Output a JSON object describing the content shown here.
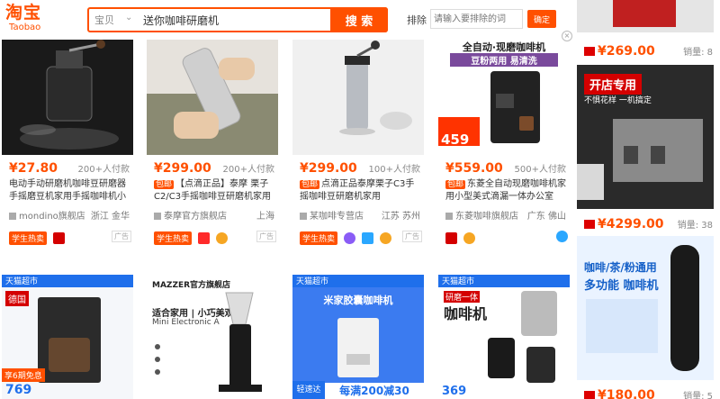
{
  "header": {
    "logo_cn": "淘宝",
    "logo_en": "Taobao",
    "search_category": "宝贝",
    "search_query": "送你咖啡研磨机",
    "search_button": "搜 索",
    "exclude_label": "排除",
    "exclude_placeholder": "请输入要排除的词",
    "confirm_button": "确定"
  },
  "row1": [
    {
      "price": "¥27.80",
      "sales": "200+人付款",
      "baoyou": "",
      "title": "电动手动研磨机咖啡豆研磨器手摇磨豆机家用手摇咖啡机小型",
      "shop": "mondino旗舰店",
      "loc": "浙江 金华",
      "badge": "学生热卖",
      "ad": "广告"
    },
    {
      "price": "¥299.00",
      "sales": "200+人付款",
      "baoyou": "包邮",
      "title": "【点滴正品】泰摩 栗子C2/C3手摇咖啡豆研磨机家用便携",
      "shop": "泰摩官方旗舰店",
      "loc": "上海",
      "badge": "学生热卖",
      "ad": "广告"
    },
    {
      "price": "¥299.00",
      "sales": "100+人付款",
      "baoyou": "包邮",
      "title": "点滴正品泰摩栗子C3手摇咖啡豆研磨机家用",
      "shop": "某咖啡专营店",
      "loc": "江苏 苏州",
      "badge": "学生热卖",
      "ad": "广告"
    },
    {
      "price": "¥559.00",
      "sales": "500+人付款",
      "baoyou": "包邮",
      "title": "东菱全自动现磨咖啡机家用小型美式滴漏一体办公室",
      "shop": "东菱咖啡旗舰店",
      "loc": "广东 佛山",
      "badge": "",
      "ad": "广告",
      "img_line1": "全自动·现磨咖啡机",
      "img_line2": "豆粉两用 易清洗",
      "img_price": "459"
    }
  ],
  "row2": [
    {
      "top_tag": "天猫超市",
      "country": "德国",
      "bottom": "享6期免息",
      "price_hint": "769"
    },
    {
      "brand": "MAZZER官方旗舰店",
      "line1": "适合家用 | 小巧美观",
      "line2": "Mini Electronic A"
    },
    {
      "top_tag": "天猫超市",
      "line1": "米家胶囊咖啡机",
      "tag1": "轻速达",
      "tag2": "每满200减30"
    },
    {
      "top_tag": "天猫超市",
      "line1": "咖啡机",
      "line2": "研磨一体",
      "price_hint": "369"
    }
  ],
  "right": {
    "price1": "¥269.00",
    "sales1": "销量: 8",
    "banner1": "开店专用",
    "banner1b": "不惧花样 一机搞定",
    "price2": "¥4299.00",
    "sales2": "销量: 38",
    "banner2": "咖啡/茶/粉通用",
    "banner2b": "多功能 咖啡机",
    "price3": "¥180.00",
    "sales3": "销量: 5"
  }
}
